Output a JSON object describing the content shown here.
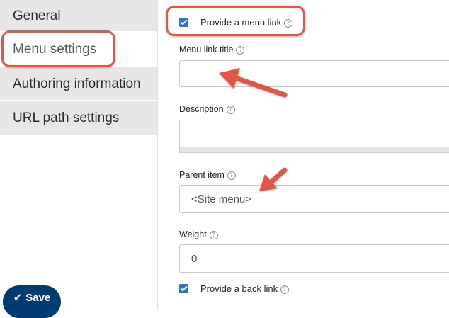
{
  "tabs": {
    "general": "General",
    "menu_settings": "Menu settings",
    "authoring": "Authoring information",
    "url_path": "URL path settings"
  },
  "form": {
    "provide_menu_link": {
      "label": "Provide a menu link",
      "checked": true
    },
    "menu_link_title": {
      "label": "Menu link title",
      "value": ""
    },
    "description": {
      "label": "Description",
      "value": ""
    },
    "parent_item": {
      "label": "Parent item",
      "selected": "<Site menu>"
    },
    "weight": {
      "label": "Weight",
      "value": "0"
    },
    "provide_back_link": {
      "label": "Provide a back link",
      "checked": true
    }
  },
  "help_glyph": "?",
  "save_button": {
    "label": "Save"
  },
  "icons": {
    "checkbox": "checkmark-icon",
    "help": "help-icon",
    "save": "checkmark-icon"
  },
  "colors": {
    "annotation": "#e25648",
    "checkbox": "#2f6fd4",
    "save_button": "#003b73",
    "tab_background": "#e7e7e7"
  }
}
